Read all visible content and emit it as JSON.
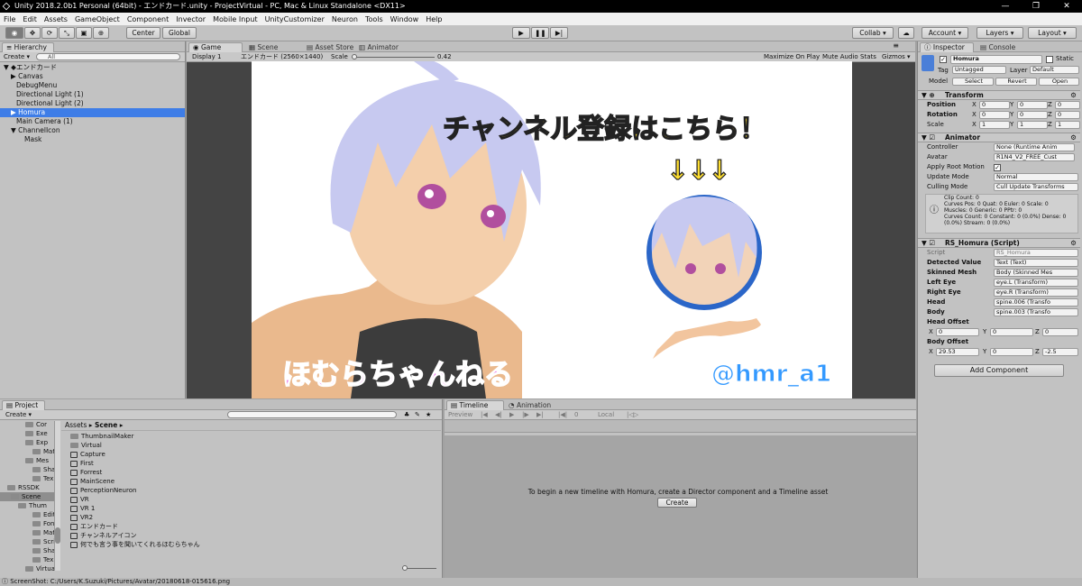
{
  "window": {
    "title": "Unity 2018.2.0b1 Personal (64bit) - エンドカード.unity - ProjectVirtual - PC, Mac & Linux Standalone <DX11>"
  },
  "menu": [
    "File",
    "Edit",
    "Assets",
    "GameObject",
    "Component",
    "Invector",
    "Mobile Input",
    "UnityCustomizer",
    "Neuron",
    "Tools",
    "Window",
    "Help"
  ],
  "toolbar": {
    "center": "Center",
    "global": "Global",
    "collab": "Collab ▾",
    "account": "Account ▾",
    "layers": "Layers ▾",
    "layout": "Layout ▾"
  },
  "hierarchy": {
    "tab": "Hierarchy",
    "create": "Create ▾",
    "search": "All",
    "scene": "エンドカード",
    "items": [
      "Canvas",
      "DebugMenu",
      "Directional Light (1)",
      "Directional Light (2)",
      "Homura",
      "Main Camera (1)",
      "ChannelIcon",
      "Mask"
    ]
  },
  "scene_tabs": {
    "game": "Game",
    "scene": "Scene",
    "asset_store": "Asset Store",
    "animator": "Animator"
  },
  "game_bar": {
    "display": "Display 1",
    "resolution": "エンドカード (2560×1440)",
    "scale_label": "Scale",
    "scale_value": "0.42",
    "maximize": "Maximize On Play",
    "mute": "Mute Audio",
    "stats": "Stats",
    "gizmos": "Gizmos ▾"
  },
  "game_view": {
    "headline": "チャンネル登録はこちら！",
    "arrows": "↓↓↓",
    "channel_name": "ほむらちゃんねる",
    "handle": "@hmr_a1"
  },
  "project": {
    "tab": "Project",
    "create": "Create ▾",
    "breadcrumb": [
      "Assets",
      "Scene"
    ],
    "tree": [
      "Cor",
      "Exe",
      "Exp",
      "Mat",
      "Mes",
      "Sha",
      "Tex",
      "RSSDK",
      "Scene",
      "Thum",
      "Edit",
      "Fon",
      "Mat",
      "Scri",
      "Sha",
      "Tex",
      "Virtua"
    ],
    "folders": [
      "ThumbnailMaker",
      "Virtual"
    ],
    "scenes": [
      "Capture",
      "First",
      "Forrest",
      "MainScene",
      "PerceptionNeuron",
      "VR",
      "VR 1",
      "VR2",
      "エンドカード",
      "チャンネルアイコン",
      "何でも言う事を聞いてくれるほむらちゃん"
    ]
  },
  "timeline": {
    "tab": "Timeline",
    "animation_tab": "Animation",
    "preview": "Preview",
    "frame": "0",
    "local": "Local",
    "message": "To begin a new timeline with Homura, create a Director component and a Timeline asset",
    "create": "Create"
  },
  "inspector": {
    "tab": "Inspector",
    "console_tab": "Console",
    "name": "Homura",
    "static": "Static",
    "tag_label": "Tag",
    "tag": "Untagged",
    "layer_label": "Layer",
    "layer": "Default",
    "model_label": "Model",
    "select": "Select",
    "revert": "Revert",
    "open": "Open",
    "transform": {
      "title": "Transform",
      "position": [
        "0",
        "0",
        "0"
      ],
      "rotation": [
        "0",
        "0",
        "0"
      ],
      "scale": [
        "1",
        "1",
        "1"
      ]
    },
    "animator": {
      "title": "Animator",
      "controller": "None (Runtime Anim",
      "avatar": "R1N4_V2_FREE_Cust",
      "update_mode": "Normal",
      "culling_mode": "Cull Update Transforms",
      "info": [
        "Clip Count: 0",
        "Curves Pos: 0 Quat: 0 Euler: 0 Scale: 0",
        "Muscles: 0 Generic: 0 PPtr: 0",
        "Curves Count: 0 Constant: 0 (0.0%) Dense: 0",
        "(0.0%) Stream: 0 (0.0%)"
      ]
    },
    "script": {
      "title": "RS_Homura (Script)",
      "script": "RS_Homura",
      "detected": "Text (Text)",
      "skinned": "Body (Skinned Mes",
      "left_eye": "eye.L (Transform)",
      "right_eye": "eye.R (Transform)",
      "head": "spine.006 (Transfo",
      "body": "spine.003 (Transfo",
      "head_offset": [
        "0",
        "0",
        "0"
      ],
      "body_offset": [
        "29.53",
        "0",
        "-2.5"
      ]
    },
    "add_component": "Add Component"
  },
  "status": {
    "text": "ScreenShot: C:/Users/K.Suzuki/Pictures/Avatar/20180618-015616.png"
  }
}
